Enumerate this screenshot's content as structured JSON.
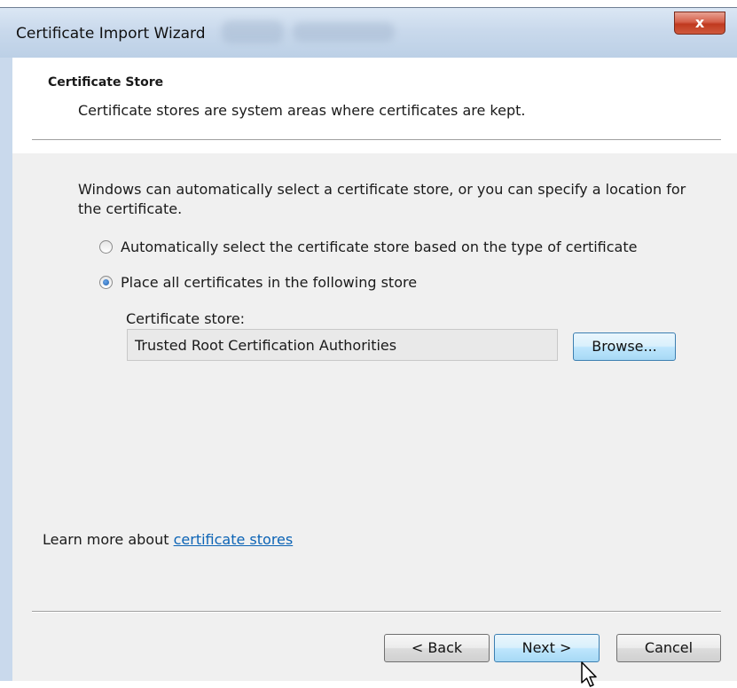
{
  "window": {
    "title": "Certificate Import Wizard",
    "close_label": "x"
  },
  "header": {
    "title": "Certificate Store",
    "description": "Certificate stores are system areas where certificates are kept."
  },
  "body": {
    "intro": "Windows can automatically select a certificate store, or you can specify a location for the certificate.",
    "options": [
      {
        "label": "Automatically select the certificate store based on the type of certificate",
        "selected": false
      },
      {
        "label": "Place all certificates in the following store",
        "selected": true
      }
    ],
    "store_label": "Certificate store:",
    "store_value": "Trusted Root Certification Authorities",
    "browse_label": "Browse..."
  },
  "learn_more": {
    "prefix": "Learn more about ",
    "link_text": "certificate stores"
  },
  "footer": {
    "back_label": "< Back",
    "next_label": "Next >",
    "cancel_label": "Cancel"
  },
  "icons": {
    "close": "close-icon",
    "cursor": "mouse-pointer-icon"
  },
  "colors": {
    "link": "#0b63b5",
    "close_button": "#c0391f",
    "focused_button_border": "#3c7fb1"
  }
}
